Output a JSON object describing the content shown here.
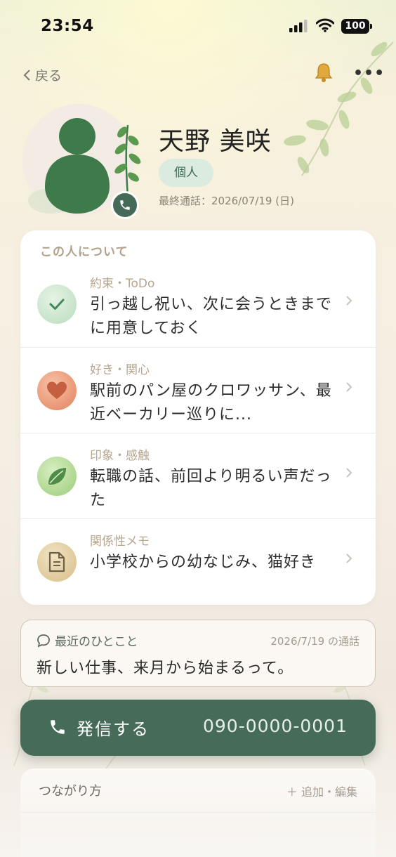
{
  "status_bar": {
    "time": "23:54",
    "battery": "100"
  },
  "nav": {
    "back_label": "戻る",
    "bell_icon": "bell-icon",
    "more_label": "•••"
  },
  "profile": {
    "name": "天野 美咲",
    "tag": "個人",
    "last_call": "最終通話：2026/07/19 (日)"
  },
  "about": {
    "title": "この人について",
    "items": [
      {
        "category": "約束・ToDo",
        "text": "引っ越し祝い、次に会うときまでに用意しておく",
        "icon": "check-icon",
        "color": "#4f9a6a"
      },
      {
        "category": "好き・関心",
        "text": "駅前のパン屋のクロワッサン、最近ベーカリー巡りに...",
        "icon": "heart-icon",
        "color": "#d7704f"
      },
      {
        "category": "印象・感触",
        "text": "転職の話、前回より明るい声だった",
        "icon": "leaf-icon",
        "color": "#7fb35a"
      },
      {
        "category": "関係性メモ",
        "text": "小学校からの幼なじみ、猫好き",
        "icon": "document-icon",
        "color": "#c9a972"
      }
    ]
  },
  "recent": {
    "label": "最近のひとこと",
    "date": "2026/7/19 の通話",
    "message": "新しい仕事、来月から始まるって。"
  },
  "call": {
    "label": "発信する",
    "number": "090-0000-0001"
  },
  "connections": {
    "title": "つながり方",
    "action": "＋ 追加・編集"
  },
  "colors": {
    "accent": "#466b59",
    "tag_bg": "#dcebdf"
  }
}
